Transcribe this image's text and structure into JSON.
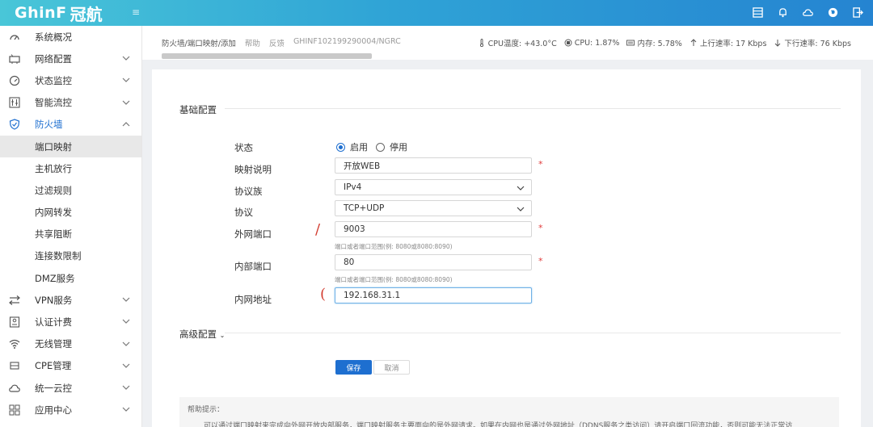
{
  "app": {
    "logo_text": "GhinF",
    "logo_cn": "冠航"
  },
  "header": {
    "breadcrumb": "防火墙/端口映射/添加",
    "help_link": "帮助",
    "feedback_link": "反馈",
    "device_id": "GHINF102199290004/NGRC",
    "stats": {
      "cpu_temp": "CPU温度: +43.0°C",
      "cpu": "CPU: 1.87%",
      "memory": "内存: 5.78%",
      "up_rate": "上行速率: 17 Kbps",
      "down_rate": "下行速率: 76 Kbps"
    }
  },
  "sidebar": {
    "items": [
      {
        "label": "系统概况",
        "icon": "dashboard-icon"
      },
      {
        "label": "网络配置",
        "icon": "network-icon"
      },
      {
        "label": "状态监控",
        "icon": "gauge-icon"
      },
      {
        "label": "智能流控",
        "icon": "sliders-icon"
      },
      {
        "label": "防火墙",
        "icon": "shield-icon"
      }
    ],
    "firewall_sub": [
      "端口映射",
      "主机放行",
      "过滤规则",
      "内网转发",
      "共享阻断",
      "连接数限制",
      "DMZ服务"
    ],
    "items_after": [
      {
        "label": "VPN服务",
        "icon": "vpn-icon"
      },
      {
        "label": "认证计费",
        "icon": "auth-icon"
      },
      {
        "label": "无线管理",
        "icon": "wifi-icon"
      },
      {
        "label": "CPE管理",
        "icon": "cpe-icon"
      },
      {
        "label": "统一云控",
        "icon": "cloud-icon"
      },
      {
        "label": "应用中心",
        "icon": "apps-icon"
      }
    ]
  },
  "form": {
    "basic_title": "基础配置",
    "advanced_title": "高级配置",
    "status_label": "状态",
    "status_on": "启用",
    "status_off": "停用",
    "status_value": "启用",
    "desc_label": "映射说明",
    "desc_value": "开放WEB",
    "family_label": "协议族",
    "family_value": "IPv4",
    "protocol_label": "协议",
    "protocol_value": "TCP+UDP",
    "ext_port_label": "外网端口",
    "ext_port_value": "9003",
    "ext_port_hint": "端口或者端口范围(例: 8080或8080:8090)",
    "int_port_label": "内部端口",
    "int_port_value": "80",
    "int_port_hint": "端口或者端口范围(例: 8080或8080:8090)",
    "lan_addr_label": "内网地址",
    "lan_addr_value": "192.168.31.1",
    "save_label": "保存",
    "cancel_label": "取消",
    "required_mark": "*"
  },
  "help": {
    "title": "帮助提示：",
    "text": "可以通过端口映射来完成向外网开放内部服务，端口映射服务主要面向的是外网请求。如果在内网也是通过外网地址（DDNS服务之类访问）请开启端口回流功能，否则可能无法正常访"
  },
  "colors": {
    "accent": "#1e6fd0",
    "required": "#e03a3a",
    "topbar_start": "#49c6d8",
    "topbar_end": "#2584d1"
  }
}
